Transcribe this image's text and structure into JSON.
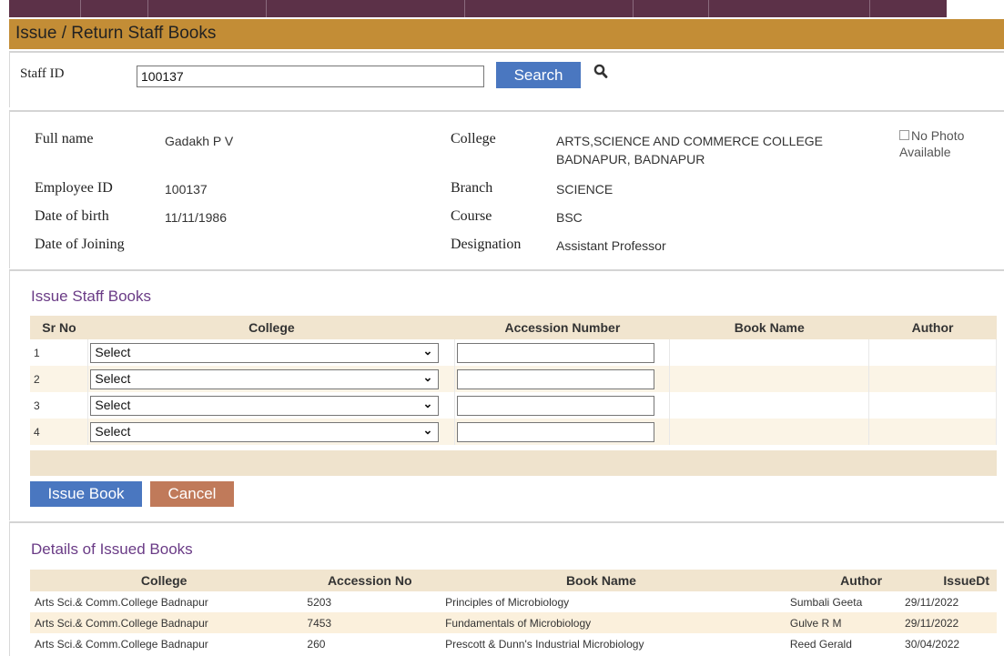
{
  "page": {
    "header_title": "Issue / Return Staff Books"
  },
  "search": {
    "label": "Staff ID",
    "value": "100137",
    "button_label": "Search"
  },
  "staff": {
    "full_name_label": "Full name",
    "full_name": "Gadakh P V",
    "employee_id_label": "Employee ID",
    "employee_id": "100137",
    "dob_label": "Date of birth",
    "dob": "11/11/1986",
    "doj_label": "Date of Joining",
    "college_label": "College",
    "college_line1": "ARTS,SCIENCE AND COMMERCE COLLEGE",
    "college_line2": "BADNAPUR, BADNAPUR",
    "branch_label": "Branch",
    "branch": "SCIENCE",
    "course_label": "Course",
    "course": "BSC",
    "designation_label": "Designation",
    "designation": "Assistant Professor",
    "photo_alt_line1": "No Photo",
    "photo_alt_line2": "Available"
  },
  "issue": {
    "title": "Issue Staff Books",
    "headers": [
      "Sr No",
      "College",
      "Accession Number",
      "Book Name",
      "Author"
    ],
    "rows": [
      {
        "sr": "1",
        "college": "Select"
      },
      {
        "sr": "2",
        "college": "Select"
      },
      {
        "sr": "3",
        "college": "Select"
      },
      {
        "sr": "4",
        "college": "Select"
      }
    ],
    "issue_button": "Issue Book",
    "cancel_button": "Cancel"
  },
  "issued": {
    "title": "Details of Issued Books",
    "headers": [
      "College",
      "Accession No",
      "Book Name",
      "Author",
      "IssueDt"
    ],
    "rows": [
      [
        "Arts Sci.& Comm.College Badnapur",
        "5203",
        "Principles of Microbiology",
        "Sumbali Geeta",
        "29/11/2022"
      ],
      [
        "Arts Sci.& Comm.College Badnapur",
        "7453",
        "Fundamentals of Microbiology",
        "Gulve R M",
        "29/11/2022"
      ],
      [
        "Arts Sci.& Comm.College Badnapur",
        "260",
        "Prescott & Dunn's Industrial Microbiology",
        "Reed Gerald",
        "30/04/2022"
      ]
    ]
  },
  "colors": {
    "header_bg": "#c38d36",
    "nav_bg": "#5c3148",
    "search_btn": "#4a77c0",
    "issue_btn": "#4a77c0",
    "cancel_btn": "#c07a5a",
    "section_title": "#6a3b86",
    "table_header": "#f1e5cf"
  }
}
